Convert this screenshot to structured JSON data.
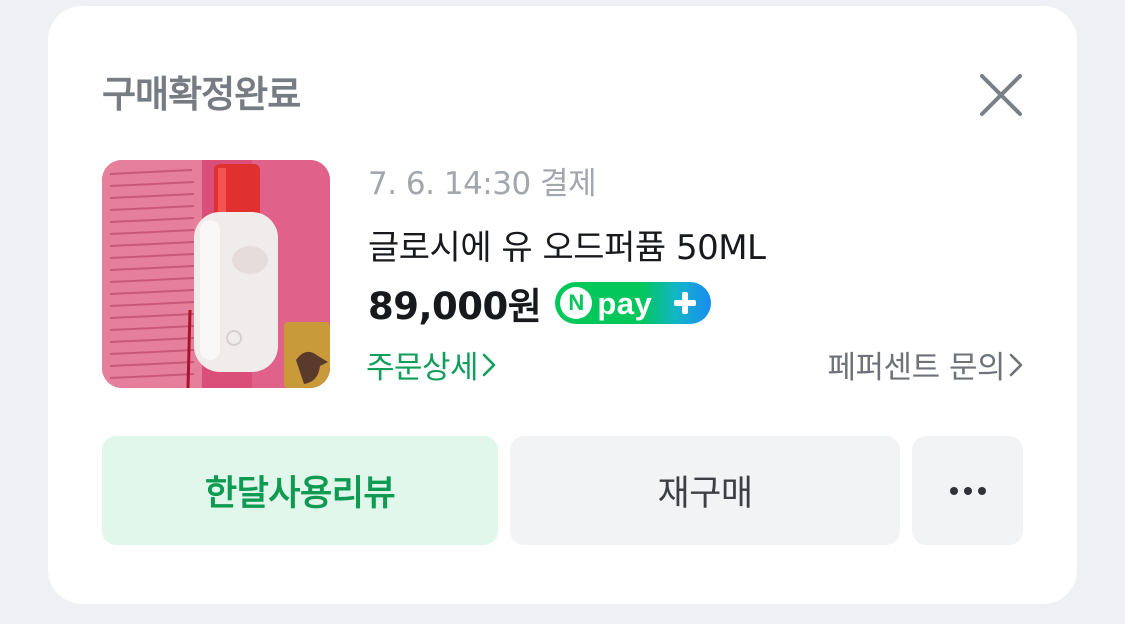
{
  "card": {
    "status_title": "구매확정완료",
    "payment_info": "7. 6. 14:30 결제",
    "product_name": "글로시에 유 오드퍼퓸 50ML",
    "price": "89,000원",
    "npay_badge": "pay",
    "npay_letter": "N",
    "order_detail_link": "주문상세",
    "inquiry_link": "페퍼센트 문의"
  },
  "buttons": {
    "review": "한달사용리뷰",
    "rebuy": "재구매"
  },
  "colors": {
    "accent_green": "#03c75a",
    "link_green": "#0f9f5a",
    "review_bg": "#e2f7ec"
  }
}
